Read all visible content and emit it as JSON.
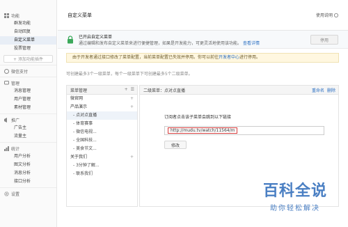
{
  "sidebar": {
    "groups": [
      {
        "title": "功能",
        "items": [
          "群发功能",
          "自动回复",
          "自定义菜单",
          "投票管理"
        ]
      },
      {
        "title": "微信支付",
        "items": []
      },
      {
        "title": "管理",
        "items": [
          "消息管理",
          "用户管理",
          "素材管理"
        ]
      },
      {
        "title": "推广",
        "items": [
          "广告主",
          "流量主"
        ]
      },
      {
        "title": "统计",
        "items": [
          "用户分析",
          "图文分析",
          "消息分析",
          "接口分析"
        ]
      },
      {
        "title": "设置",
        "items": []
      }
    ],
    "add_plugin": "+ 添加功能插件"
  },
  "header": {
    "title": "自定义菜单",
    "help": "使用说明"
  },
  "notice": {
    "line1": "已开启自定义菜单",
    "line2": "通过编辑和发布自定义菜单来进行便捷管理，如果是开发能力，可更灵活地使用该功能。",
    "link": "查看详情",
    "stop": "停用"
  },
  "warning": {
    "text": "由于开发者通过接口修改了菜单配置，当前菜单配置已失效并停用。你可以前往",
    "link": "开发者中心",
    "suffix": "进行停用。"
  },
  "hint": "可创建最多3个一级菜单，每个一级菜单下可创建最多5个二级菜单。",
  "menu_panel": {
    "title": "菜单管理",
    "tools": [
      "+",
      "☰"
    ],
    "rows": [
      {
        "label": "微官网",
        "sub": false,
        "plus": true
      },
      {
        "label": "产品演示",
        "sub": false,
        "plus": true
      },
      {
        "label": "- 点对点直播",
        "sub": true,
        "plus": false,
        "selected": true
      },
      {
        "label": "- 体育赛事",
        "sub": true,
        "plus": false
      },
      {
        "label": "- 微信电视...",
        "sub": true,
        "plus": false
      },
      {
        "label": "- 全国科技...",
        "sub": true,
        "plus": false
      },
      {
        "label": "- 美食节文...",
        "sub": true,
        "plus": false
      },
      {
        "label": "关于我们",
        "sub": false,
        "plus": true
      },
      {
        "label": "- 3分钟了解...",
        "sub": true,
        "plus": false
      },
      {
        "label": "- 联系我们",
        "sub": true,
        "plus": false
      }
    ]
  },
  "editor": {
    "title": "二级菜单：点对点直播",
    "rename": "重命名",
    "delete": "删除",
    "label": "订阅者点击该子菜单会跳到以下链接",
    "url": "http://mudu.tv/watch/11564/m",
    "modify": "修改"
  },
  "watermark": {
    "big": "百科全说",
    "small": "助你轻松解决"
  }
}
